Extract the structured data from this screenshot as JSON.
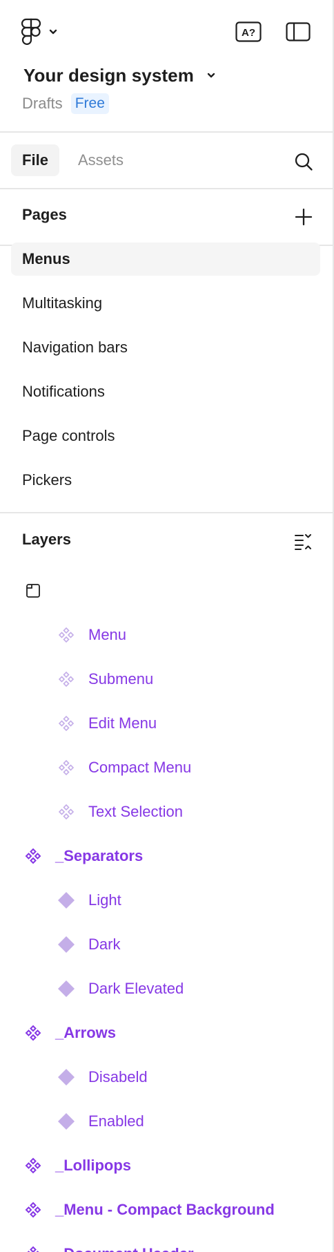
{
  "file": {
    "title": "Your design system",
    "location": "Drafts",
    "plan": "Free"
  },
  "tabs": [
    {
      "label": "File",
      "active": true
    },
    {
      "label": "Assets",
      "active": false
    }
  ],
  "pages": {
    "title": "Pages",
    "items": [
      {
        "label": "Menus",
        "selected": true
      },
      {
        "label": "Multitasking",
        "selected": false
      },
      {
        "label": "Navigation bars",
        "selected": false
      },
      {
        "label": "Notifications",
        "selected": false
      },
      {
        "label": "Page controls",
        "selected": false
      },
      {
        "label": "Pickers",
        "selected": false
      }
    ]
  },
  "layers": {
    "title": "Layers",
    "items": [
      {
        "label": "",
        "icon": "section-icon",
        "depth": 0,
        "bold": false
      },
      {
        "label": "Menu",
        "icon": "instance-icon",
        "depth": 1,
        "bold": false
      },
      {
        "label": "Submenu",
        "icon": "instance-icon",
        "depth": 1,
        "bold": false
      },
      {
        "label": "Edit Menu",
        "icon": "instance-icon",
        "depth": 1,
        "bold": false
      },
      {
        "label": "Compact Menu",
        "icon": "instance-icon",
        "depth": 1,
        "bold": false
      },
      {
        "label": "Text Selection",
        "icon": "instance-icon",
        "depth": 1,
        "bold": false
      },
      {
        "label": "_Separators",
        "icon": "component-set-icon",
        "depth": 0,
        "bold": true
      },
      {
        "label": "Light",
        "icon": "component-icon",
        "depth": 1,
        "bold": false
      },
      {
        "label": "Dark",
        "icon": "component-icon",
        "depth": 1,
        "bold": false
      },
      {
        "label": "Dark Elevated",
        "icon": "component-icon",
        "depth": 1,
        "bold": false
      },
      {
        "label": "_Arrows",
        "icon": "component-set-icon",
        "depth": 0,
        "bold": true
      },
      {
        "label": "Disabeld",
        "icon": "component-icon",
        "depth": 1,
        "bold": false
      },
      {
        "label": "Enabled",
        "icon": "component-icon",
        "depth": 1,
        "bold": false
      },
      {
        "label": "_Lollipops",
        "icon": "component-set-icon",
        "depth": 0,
        "bold": true
      },
      {
        "label": "_Menu - Compact Background",
        "icon": "component-set-icon",
        "depth": 0,
        "bold": true
      },
      {
        "label": "_Document Header",
        "icon": "component-set-icon",
        "depth": 0,
        "bold": true
      }
    ]
  },
  "colors": {
    "component": "#8638e5",
    "component_light": "#c4aee8",
    "badge_text": "#2f7ad8",
    "badge_bg": "#e9f3ff",
    "divider": "#e6e6e6"
  }
}
